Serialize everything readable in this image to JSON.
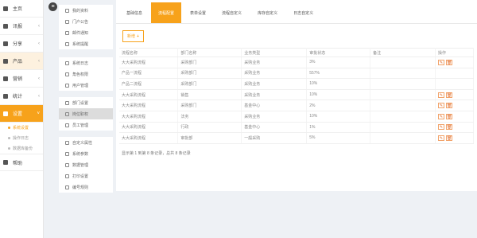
{
  "sidebar": {
    "items": [
      {
        "label": "主页",
        "icon": "home-icon",
        "arrow": ""
      },
      {
        "label": "讯报",
        "icon": "news-icon",
        "arrow": "‹"
      },
      {
        "label": "分享",
        "icon": "share-icon",
        "arrow": "‹"
      },
      {
        "label": "产品",
        "icon": "product-icon",
        "arrow": "‹"
      },
      {
        "label": "营销",
        "icon": "marketing-icon",
        "arrow": "‹"
      },
      {
        "label": "统计",
        "icon": "stats-icon",
        "arrow": "‹"
      },
      {
        "label": "设置",
        "icon": "gear-icon",
        "arrow": "˅"
      }
    ],
    "sub_items": [
      {
        "label": "系统设置"
      },
      {
        "label": "操作日志"
      },
      {
        "label": "数据库备份"
      }
    ],
    "last_item": {
      "label": "帮助",
      "icon": "help-icon"
    }
  },
  "subnav": {
    "groups": [
      [
        {
          "label": "我的资料",
          "icon": "profile-icon"
        },
        {
          "label": "门户公告",
          "icon": "notice-icon"
        },
        {
          "label": "邮件通知",
          "icon": "mail-icon"
        },
        {
          "label": "系统提醒",
          "icon": "bell-icon"
        }
      ],
      [
        {
          "label": "系统日志",
          "icon": "log-icon"
        },
        {
          "label": "角色权限",
          "icon": "role-icon"
        },
        {
          "label": "用户管理",
          "icon": "user-icon"
        }
      ],
      [
        {
          "label": "部门设置",
          "icon": "dept-icon"
        },
        {
          "label": "岗位职权",
          "icon": "post-icon"
        },
        {
          "label": "员工管理",
          "icon": "staff-icon"
        }
      ],
      [
        {
          "label": "自定义属性",
          "icon": "attr-icon"
        },
        {
          "label": "系统参数",
          "icon": "param-icon"
        },
        {
          "label": "数据管理",
          "icon": "data-icon"
        },
        {
          "label": "打印设置",
          "icon": "print-icon"
        },
        {
          "label": "编号规则",
          "icon": "rule-icon"
        }
      ]
    ]
  },
  "tabs": [
    "基础信息",
    "流程配置",
    "表单设置",
    "流程自定义",
    "库存自定义",
    "日志自定义"
  ],
  "toolbar": {
    "add_label": "新增",
    "add_symbol": "+"
  },
  "table": {
    "headers": [
      "流程名称",
      "部门名称",
      "业务类型",
      "审批状态",
      "备注",
      "操作"
    ],
    "rows": [
      [
        "大大采购流程",
        "采购部门",
        "采购业务",
        "3%",
        "",
        "edit"
      ],
      [
        "产品一流程",
        "采购部门",
        "采购业务",
        "557%",
        "",
        ""
      ],
      [
        "产品二流程",
        "采购部门",
        "采购业务",
        "10%",
        "",
        ""
      ],
      [
        "大大采购流程",
        "销售",
        "采购业务",
        "10%",
        "",
        "edit"
      ],
      [
        "大大采购流程",
        "采购部门",
        "基金中心",
        "2%",
        "",
        "edit"
      ],
      [
        "大大采购流程",
        "法务",
        "采购业务",
        "10%",
        "",
        "edit"
      ],
      [
        "大大采购流程",
        "行政",
        "基金中心",
        "1%",
        "",
        "edit"
      ],
      [
        "大大采购流程",
        "审批部",
        "一般采购",
        "5%",
        "",
        "edit"
      ]
    ],
    "edit_icon": "✎",
    "delete_icon": "🗑"
  },
  "footer": {
    "info": "显示第 1 到第 8 条记录，总共 8 条记录"
  },
  "colors": {
    "accent": "#f7a21b",
    "sidebar_bg": "#ffffff",
    "page_bg": "#eef1f5"
  }
}
